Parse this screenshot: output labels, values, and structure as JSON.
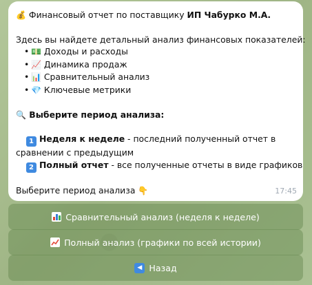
{
  "message": {
    "header_prefix": "Финансовый отчет по поставщику ",
    "header_supplier": "ИП Чабурко М.А.",
    "intro": "Здесь вы найдете детальный анализ финансовых показателей:",
    "bullets": [
      {
        "icon": "money-icon",
        "label": "Доходы и расходы"
      },
      {
        "icon": "trend-chart-icon",
        "label": "Динамика продаж"
      },
      {
        "icon": "bar-chart-icon",
        "label": "Сравнительный анализ"
      },
      {
        "icon": "diamond-icon",
        "label": "Ключевые метрики"
      }
    ],
    "prompt_heading": "Выберите период анализа:",
    "option1_num": "1",
    "option1_title": "Неделя к неделе",
    "option1_desc_a": " - последний полученный отчет в",
    "option1_desc_b": "сравнении с предыдущим",
    "option2_num": "2",
    "option2_title": "Полный отчет",
    "option2_desc": " - все полученные отчеты в виде графиков",
    "footer": "Выберите период анализа",
    "time": "17:45"
  },
  "buttons": {
    "compare_label": "Сравнительный анализ (неделя к неделе)",
    "full_label": "Полный анализ (графики по всей истории)",
    "back_label": "Назад"
  }
}
